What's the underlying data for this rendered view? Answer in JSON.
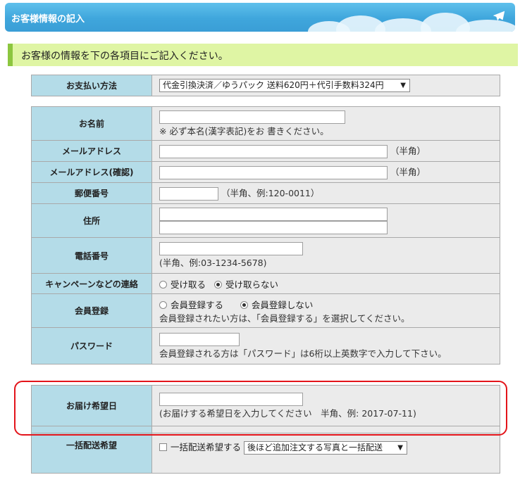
{
  "header": {
    "title": "お客様情報の記入",
    "plane_icon": "airplane-icon"
  },
  "intro": {
    "heading": "お客様の情報を下の各項目にご記入ください。"
  },
  "payment": {
    "label": "お支払い方法",
    "selected": "代金引換決済／ゆうパック 送料620円＋代引手数料324円"
  },
  "fields": {
    "name": {
      "label": "お名前",
      "value": "",
      "note": "※ 必ず本名(漢字表記)をお 書きください。"
    },
    "email": {
      "label": "メールアドレス",
      "value": "",
      "note": "（半角）"
    },
    "email_confirm": {
      "label": "メールアドレス(確認)",
      "value": "",
      "note": "（半角）"
    },
    "postal": {
      "label": "郵便番号",
      "value": "",
      "note": "（半角、例:120-0011）"
    },
    "address": {
      "label": "住所",
      "line1": "",
      "line2": ""
    },
    "phone": {
      "label": "電話番号",
      "value": "",
      "note": "(半角、例:03-1234-5678)"
    },
    "campaign": {
      "label": "キャンペーンなどの連絡",
      "options": [
        "受け取る",
        "受け取らない"
      ],
      "selected": "受け取らない"
    },
    "membership": {
      "label": "会員登録",
      "options": [
        "会員登録する",
        "会員登録しない"
      ],
      "selected": "会員登録しない",
      "note": "会員登録されたい方は、「会員登録する」を選択してください。"
    },
    "password": {
      "label": "パスワード",
      "value": "",
      "note": "会員登録される方は「パスワード」は6桁以上英数字で入力して下さい。"
    },
    "delivery_date": {
      "label": "お届け希望日",
      "value": "",
      "note": "(お届けする希望日を入力してください　半角、例: 2017-07-11)"
    },
    "bulk_delivery": {
      "label": "一括配送希望",
      "checkbox_label": "一括配送希望する",
      "checked": false,
      "select_value": "後ほど追加注文する写真と一括配送"
    }
  },
  "colors": {
    "title_bar": "#3fa6dc",
    "heading_bg": "#dff5a4",
    "heading_border": "#8cc63f",
    "label_bg": "#b4dce8",
    "field_bg": "#ebebeb",
    "highlight": "#e3141a"
  }
}
